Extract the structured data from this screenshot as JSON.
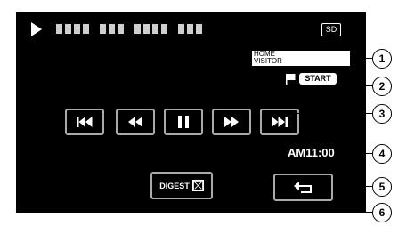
{
  "status_bar": {
    "playback_icon": "play-icon",
    "media_label": "SD"
  },
  "event_tags": {
    "home_label": "HOME",
    "visitor_label": "VISITOR",
    "start_label": "START",
    "flag_icon": "flag-icon"
  },
  "controls": [
    {
      "name": "skip-back-button",
      "icon": "skip-back-icon"
    },
    {
      "name": "rewind-button",
      "icon": "rewind-icon"
    },
    {
      "name": "pause-button",
      "icon": "pause-icon"
    },
    {
      "name": "fast-forward-button",
      "icon": "fast-forward-icon"
    },
    {
      "name": "skip-forward-button",
      "icon": "skip-forward-icon"
    }
  ],
  "clock": "AM11:00",
  "digest": {
    "label": "DIGEST",
    "icon": "digest-icon"
  },
  "back": {
    "icon": "return-icon"
  },
  "callouts": [
    "1",
    "2",
    "3",
    "4",
    "5",
    "6"
  ],
  "colors": {
    "screen_background": "#000000",
    "button_border": "#aaaaaa",
    "text": "#ffffff",
    "badge_background": "#ffffff"
  }
}
